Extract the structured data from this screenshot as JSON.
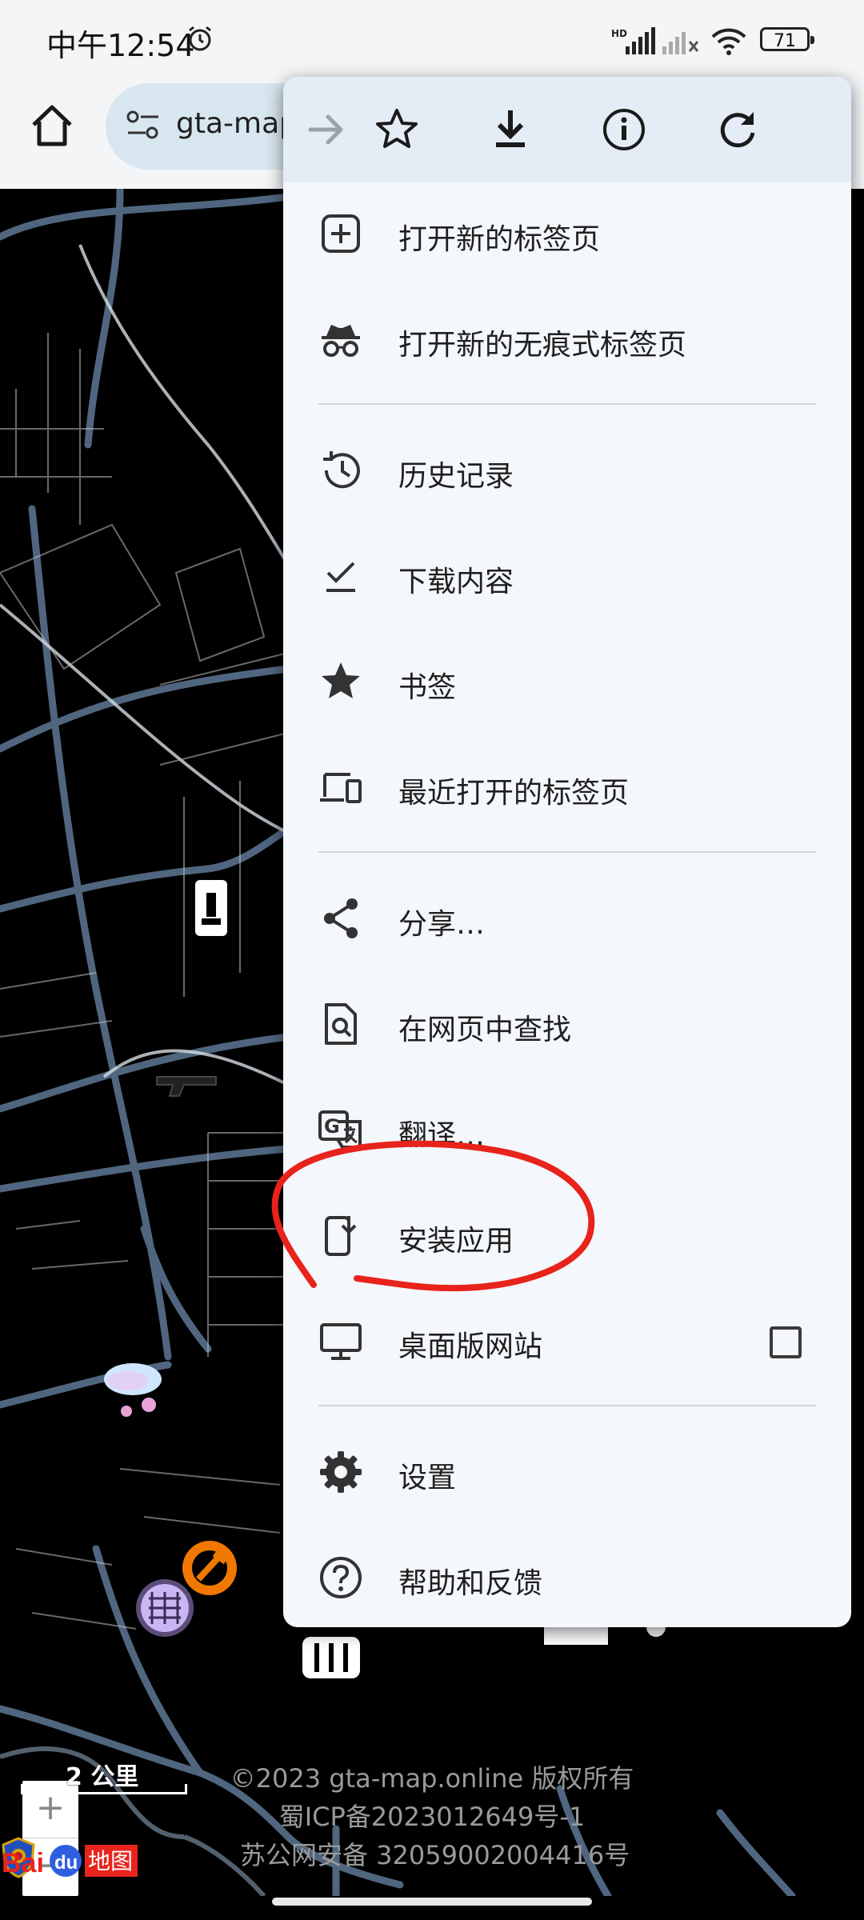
{
  "status_bar": {
    "time": "中午12:54",
    "network_label": "HD",
    "battery_level": "71"
  },
  "address_bar": {
    "url_text": "gta-map"
  },
  "menu": {
    "toolbar_icons": [
      "forward-icon",
      "bookmark-star-icon",
      "download-icon",
      "info-icon",
      "refresh-icon"
    ],
    "items": [
      {
        "label": "打开新的标签页",
        "icon": "new-tab-icon"
      },
      {
        "label": "打开新的无痕式标签页",
        "icon": "incognito-icon"
      },
      {
        "label": "历史记录",
        "icon": "history-icon"
      },
      {
        "label": "下载内容",
        "icon": "downloads-check-icon"
      },
      {
        "label": "书签",
        "icon": "star-icon"
      },
      {
        "label": "最近打开的标签页",
        "icon": "recent-tabs-icon"
      },
      {
        "label": "分享…",
        "icon": "share-icon"
      },
      {
        "label": "在网页中查找",
        "icon": "find-in-page-icon"
      },
      {
        "label": "翻译…",
        "icon": "translate-icon"
      },
      {
        "label": "安装应用",
        "icon": "install-app-icon"
      },
      {
        "label": "桌面版网站",
        "icon": "desktop-icon",
        "checked": false
      },
      {
        "label": "设置",
        "icon": "settings-gear-icon"
      },
      {
        "label": "帮助和反馈",
        "icon": "help-icon"
      }
    ]
  },
  "map": {
    "zoom_in": "+",
    "zoom_out": "−",
    "scale": "2 公里",
    "copyright_lines": [
      "©2023 gta-map.online 版权所有",
      "蜀ICP备2023012649号-1",
      "苏公网安备 32059002004416号"
    ],
    "logo_text": "Bai地图"
  },
  "colors": {
    "menu_bg": "#f4f7fb",
    "menu_top_bg": "#e4edf5",
    "omnibox_bg": "#d8e6ef",
    "annotation_red": "#e8231b",
    "road_blue": "#5e7896"
  }
}
